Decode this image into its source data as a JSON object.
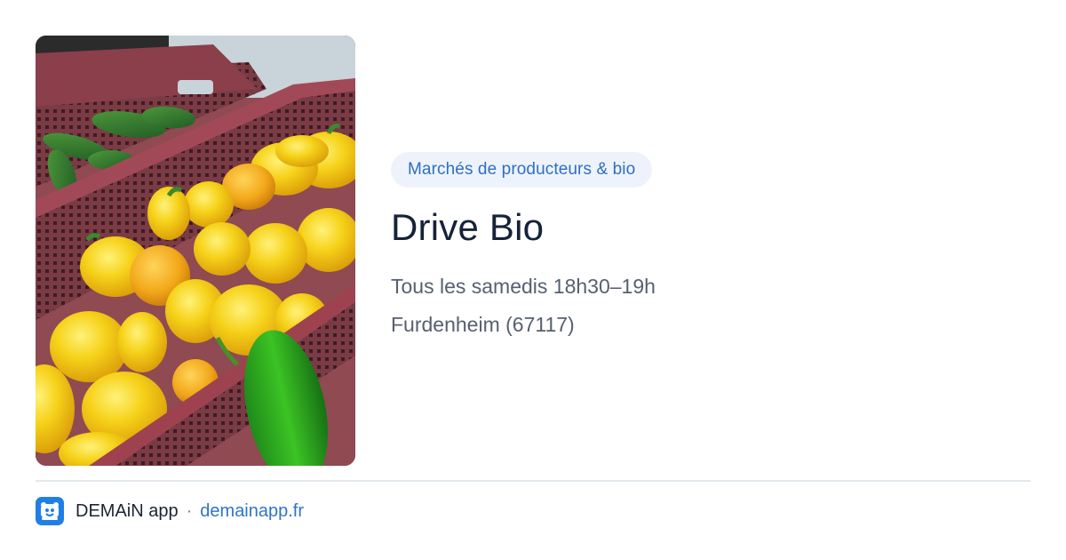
{
  "card": {
    "category": "Marchés de producteurs & bio",
    "title": "Drive Bio",
    "schedule": "Tous les samedis 18h30–19h",
    "location": "Furdenheim (67117)"
  },
  "photo": {
    "subject": "yellow-peppers-and-cucumbers-in-crates"
  },
  "footer": {
    "app_name": "DEMAiN app",
    "separator": "·",
    "site": "demainapp.fr"
  },
  "colors": {
    "tag_background": "#eef3fb",
    "tag_text": "#2f6fbf",
    "title_text": "#16223a",
    "body_text": "#56606f",
    "link": "#2f74c8",
    "logo": "#1f7fe6"
  }
}
